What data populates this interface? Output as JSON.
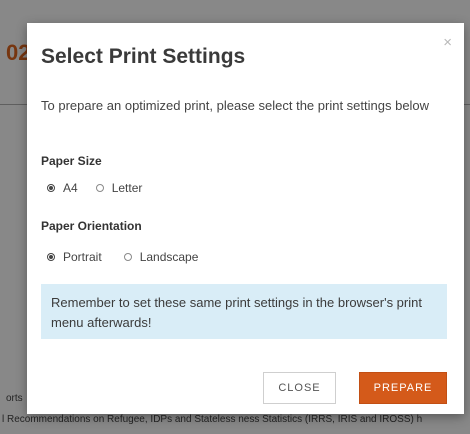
{
  "background": {
    "heading_fragment": "02",
    "footer_line_1": "orts",
    "footer_line_2": "l Recommendations on Refugee, IDPs and Stateless ness Statistics (IRRS, IRIS and IROSS) h"
  },
  "modal": {
    "close_glyph": "×",
    "title": "Select Print Settings",
    "intro": "To prepare an optimized print, please select the print settings below",
    "paper_size": {
      "label": "Paper Size",
      "options": [
        {
          "label": "A4",
          "checked": true
        },
        {
          "label": "Letter",
          "checked": false
        }
      ]
    },
    "paper_orientation": {
      "label": "Paper Orientation",
      "options": [
        {
          "label": "Portrait",
          "checked": true
        },
        {
          "label": "Landscape",
          "checked": false
        }
      ]
    },
    "info": "Remember to set these same print settings in the browser's print menu afterwards!",
    "buttons": {
      "close": "CLOSE",
      "prepare": "PREPARE"
    }
  },
  "colors": {
    "accent": "#d45a1a",
    "info_bg": "#d9edf7",
    "heading_orange": "#c0581a"
  }
}
